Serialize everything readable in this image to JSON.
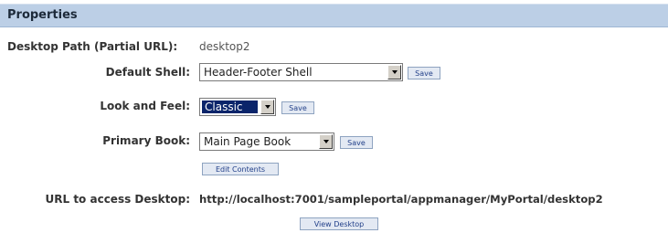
{
  "panel": {
    "title": "Properties"
  },
  "desktop_path": {
    "label": "Desktop Path (Partial URL):",
    "value": "desktop2"
  },
  "default_shell": {
    "label": "Default Shell:",
    "selected": "Header-Footer Shell",
    "save_label": "Save"
  },
  "look_and_feel": {
    "label": "Look and Feel:",
    "selected": "Classic",
    "save_label": "Save"
  },
  "primary_book": {
    "label": "Primary Book:",
    "selected": "Main Page Book",
    "save_label": "Save"
  },
  "edit_contents_label": "Edit Contents",
  "url_access": {
    "label": "URL to access Desktop:",
    "value": "http://localhost:7001/sampleportal/appmanager/MyPortal/desktop2"
  },
  "view_desktop_label": "View Desktop",
  "icons": {
    "dropdown": "chevron-down-icon"
  }
}
